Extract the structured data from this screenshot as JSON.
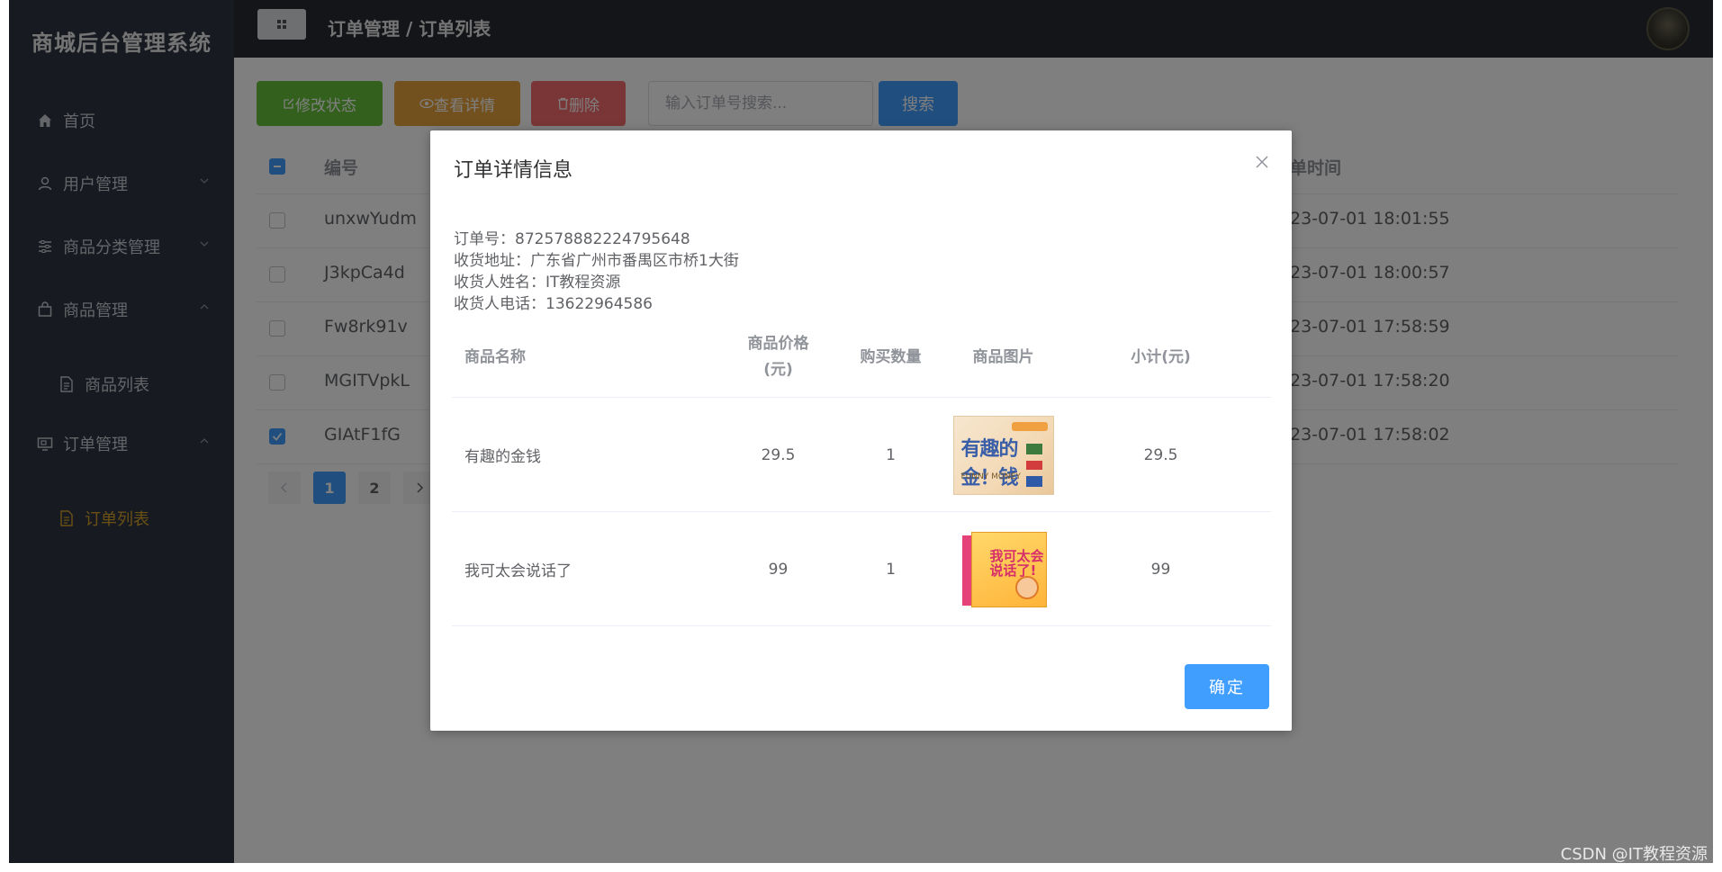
{
  "app": {
    "title": "商城后台管理系统"
  },
  "sidebar": {
    "items": [
      {
        "label": "首页",
        "icon": "home-icon"
      },
      {
        "label": "用户管理",
        "icon": "user-icon"
      },
      {
        "label": "商品分类管理",
        "icon": "sliders-icon"
      },
      {
        "label": "商品管理",
        "icon": "bag-icon"
      },
      {
        "label": "商品列表",
        "icon": "document-icon"
      },
      {
        "label": "订单管理",
        "icon": "monitor-icon"
      },
      {
        "label": "订单列表",
        "icon": "document-icon"
      }
    ]
  },
  "header": {
    "breadcrumb": "订单管理 / 订单列表"
  },
  "toolbar": {
    "edit_label": "修改状态",
    "view_label": "查看详情",
    "delete_label": "删除",
    "search_placeholder": "输入订单号搜索...",
    "search_label": "搜索"
  },
  "table": {
    "headers": {
      "id": "编号",
      "time": "单时间"
    },
    "rows": [
      {
        "id": "unxwYudm",
        "time": "23-07-01 18:01:55",
        "checked": false
      },
      {
        "id": "J3kpCa4d",
        "time": "23-07-01 18:00:57",
        "checked": false
      },
      {
        "id": "Fw8rk91v",
        "time": "23-07-01 17:58:59",
        "checked": false
      },
      {
        "id": "MGITVpkL",
        "time": "23-07-01 17:58:20",
        "checked": false
      },
      {
        "id": "GIAtF1fG",
        "time": "23-07-01 17:58:02",
        "checked": true
      }
    ]
  },
  "pagination": {
    "pages": [
      "1",
      "2"
    ],
    "current": "1"
  },
  "dialog": {
    "title": "订单详情信息",
    "order_no_label": "订单号：872578882224795648",
    "address_label": "收货地址：广东省广州市番禺区市桥1大街",
    "receiver_label": "收货人姓名：IT教程资源",
    "phone_label": "收货人电话：13622964586",
    "columns": {
      "name": "商品名称",
      "price_line1": "商品价格",
      "price_line2": "(元)",
      "qty": "购买数量",
      "image": "商品图片",
      "subtotal": "小计(元)"
    },
    "items": [
      {
        "name": "有趣的金钱",
        "price": "29.5",
        "qty": "1",
        "subtotal": "29.5",
        "cover_text": "有趣的金！钱",
        "cover_sub": "FUNNY MONEY"
      },
      {
        "name": "我可太会说话了",
        "price": "99",
        "qty": "1",
        "subtotal": "99",
        "cover_text": "我可太会说话了!"
      }
    ],
    "ok_label": "确定"
  },
  "watermark": "CSDN @IT教程资源",
  "colors": {
    "sidebar_bg": "#2f3541",
    "header_bg": "#262a31",
    "primary": "#409eff",
    "success": "#67c23a",
    "warning": "#e6a23c",
    "danger": "#f56c6c",
    "active_menu": "#d4a02a"
  }
}
